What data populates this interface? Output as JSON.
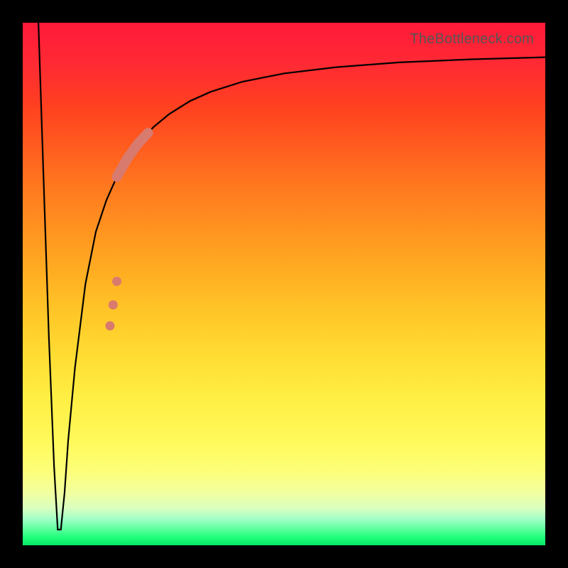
{
  "watermark": "TheBottleneck.com",
  "chart_data": {
    "type": "line",
    "title": "",
    "xlabel": "",
    "ylabel": "",
    "xlim": [
      0,
      100
    ],
    "ylim": [
      0,
      100
    ],
    "grid": false,
    "legend": false,
    "background_gradient": {
      "type": "vertical",
      "stops": [
        {
          "pos": 0.0,
          "color": "#ff1a3a"
        },
        {
          "pos": 0.5,
          "color": "#ffc828"
        },
        {
          "pos": 0.85,
          "color": "#fff95a"
        },
        {
          "pos": 1.0,
          "color": "#08e868"
        }
      ]
    },
    "series": [
      {
        "name": "bottleneck-curve",
        "x": [
          3.0,
          4.0,
          5.0,
          6.0,
          6.7,
          7.3,
          8.0,
          8.7,
          10.0,
          12.0,
          14.0,
          16.0,
          18.0,
          20.0,
          22.0,
          25.0,
          28.0,
          32.0,
          36.0,
          42.0,
          50.0,
          60.0,
          72.0,
          86.0,
          100.0
        ],
        "y": [
          100,
          70,
          40,
          15,
          3,
          3,
          10,
          20,
          34,
          50,
          60,
          66,
          70.5,
          74,
          76.8,
          80,
          82.5,
          85,
          86.8,
          88.7,
          90.3,
          91.5,
          92.4,
          93.0,
          93.4
        ]
      }
    ],
    "highlight_segment": {
      "name": "highlighted-range",
      "color": "#d97a6f",
      "x_range": [
        18.0,
        24.0
      ],
      "y_range": [
        56.0,
        74.0
      ]
    },
    "markers": [
      {
        "x": 16.7,
        "y": 42.0,
        "color": "#d97a6f"
      },
      {
        "x": 17.3,
        "y": 46.0,
        "color": "#d97a6f"
      },
      {
        "x": 18.0,
        "y": 50.5,
        "color": "#d97a6f"
      }
    ],
    "annotations": [
      {
        "text": "TheBottleneck.com",
        "role": "watermark",
        "position": "top-right"
      }
    ]
  }
}
